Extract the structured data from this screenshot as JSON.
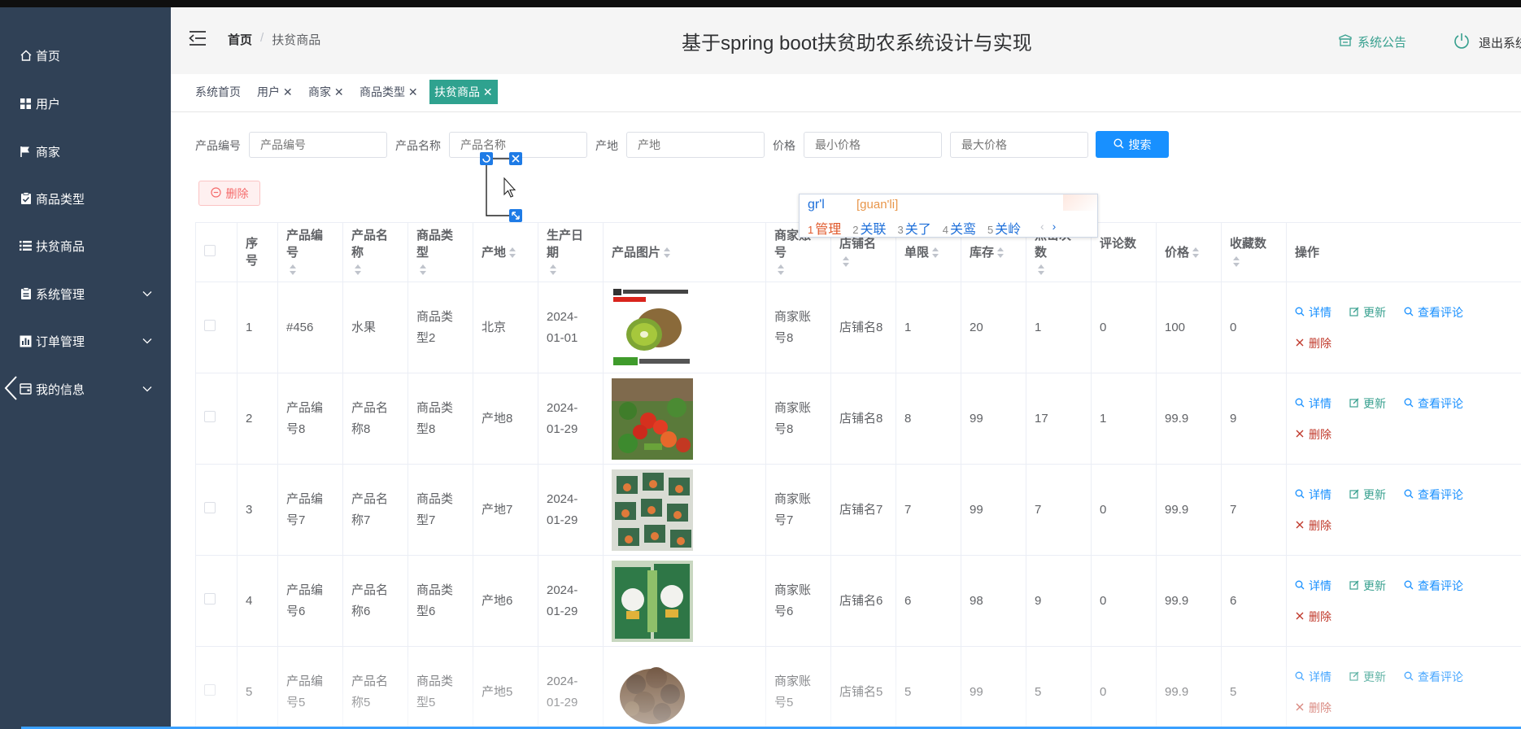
{
  "app": {
    "title": "基于spring boot扶贫助农系统设计与实现",
    "notice_label": "系统公告",
    "logout_label": "退出系统"
  },
  "sidebar": {
    "items": [
      {
        "label": "首页",
        "icon": "home-icon"
      },
      {
        "label": "用户",
        "icon": "grid-icon"
      },
      {
        "label": "商家",
        "icon": "flag-icon"
      },
      {
        "label": "商品类型",
        "icon": "checklist-icon"
      },
      {
        "label": "扶贫商品",
        "icon": "list-icon"
      },
      {
        "label": "系统管理",
        "icon": "clipboard-icon"
      },
      {
        "label": "订单管理",
        "icon": "chart-icon"
      },
      {
        "label": "我的信息",
        "icon": "wallet-icon"
      }
    ]
  },
  "breadcrumb": {
    "home": "首页",
    "separator": "/",
    "current": "扶贫商品"
  },
  "tags": [
    {
      "label": "系统首页"
    },
    {
      "label": "用户"
    },
    {
      "label": "商家"
    },
    {
      "label": "商品类型"
    },
    {
      "label": "扶贫商品"
    }
  ],
  "filters": {
    "product_no": {
      "label": "产品编号",
      "placeholder": "产品编号"
    },
    "product_name": {
      "label": "产品名称",
      "placeholder": "产品名称"
    },
    "origin": {
      "label": "产地",
      "placeholder": "产地"
    },
    "price": {
      "label": "价格",
      "min_placeholder": "最小价格",
      "max_placeholder": "最大价格"
    },
    "search_label": "搜索"
  },
  "delete_label": "删除",
  "table": {
    "headers": {
      "index": "序号",
      "no": "产品编号",
      "name": "产品名称",
      "type": "商品类型",
      "origin": "产地",
      "date": "生产日期",
      "image": "产品图片",
      "merchant": "商家账号",
      "shop": "店铺名",
      "limit": "单限",
      "stock": "库存",
      "clicks": "点击次数",
      "comments": "评论数",
      "price": "价格",
      "favs": "收藏数",
      "ops": "操作"
    },
    "actions": {
      "detail": "详情",
      "update": "更新",
      "comments": "查看评论",
      "delete": "删除"
    },
    "rows": [
      {
        "index": "1",
        "no": "#456",
        "name": "水果",
        "type": "商品类型2",
        "origin": "北京",
        "date": "2024-01-01",
        "image": "kiwi",
        "merchant": "商家账号8",
        "shop": "店铺名8",
        "limit": "1",
        "stock": "20",
        "clicks": "1",
        "comments": "0",
        "price": "100",
        "favs": "0"
      },
      {
        "index": "2",
        "no": "产品编号8",
        "name": "产品名称8",
        "type": "商品类型8",
        "origin": "产地8",
        "date": "2024-01-29",
        "image": "vegetables",
        "merchant": "商家账号8",
        "shop": "店铺名8",
        "limit": "8",
        "stock": "99",
        "clicks": "17",
        "comments": "1",
        "price": "99.9",
        "favs": "9"
      },
      {
        "index": "3",
        "no": "产品编号7",
        "name": "产品名称7",
        "type": "商品类型7",
        "origin": "产地7",
        "date": "2024-01-29",
        "image": "produce-boxes",
        "merchant": "商家账号7",
        "shop": "店铺名7",
        "limit": "7",
        "stock": "99",
        "clicks": "7",
        "comments": "0",
        "price": "99.9",
        "favs": "7"
      },
      {
        "index": "4",
        "no": "产品编号6",
        "name": "产品名称6",
        "type": "商品类型6",
        "origin": "产地6",
        "date": "2024-01-29",
        "image": "chicken-pack",
        "merchant": "商家账号6",
        "shop": "店铺名6",
        "limit": "6",
        "stock": "98",
        "clicks": "9",
        "comments": "0",
        "price": "99.9",
        "favs": "6"
      },
      {
        "index": "5",
        "no": "产品编号5",
        "name": "产品名称5",
        "type": "商品类型5",
        "origin": "产地5",
        "date": "2024-01-29",
        "image": "mushrooms",
        "merchant": "商家账号5",
        "shop": "店铺名5",
        "limit": "5",
        "stock": "99",
        "clicks": "5",
        "comments": "0",
        "price": "99.9",
        "favs": "5"
      }
    ]
  },
  "ime": {
    "typed": "gr'l",
    "pinyin": "[guan'li]",
    "candidates": [
      {
        "n": "1",
        "text": "管理"
      },
      {
        "n": "2",
        "text": "关联"
      },
      {
        "n": "3",
        "text": "关了"
      },
      {
        "n": "4",
        "text": "关鸾"
      },
      {
        "n": "5",
        "text": "关岭"
      }
    ],
    "prev": "‹",
    "next": "›"
  },
  "colors": {
    "sidebar": "#304156",
    "accent": "#2fa28f",
    "primary": "#1890ff",
    "danger": "#f56c6c"
  }
}
